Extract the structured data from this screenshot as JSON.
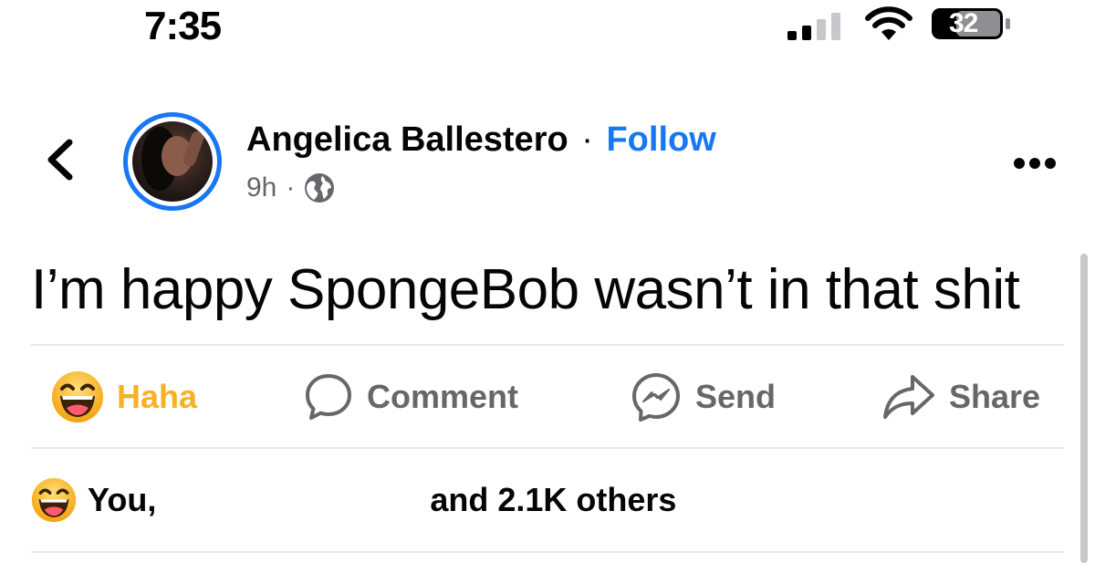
{
  "status_bar": {
    "time": "7:35",
    "battery": "32",
    "icons": [
      "cellular-signal-icon",
      "wifi-icon",
      "battery-icon"
    ]
  },
  "post": {
    "author": "Angelica Ballestero",
    "separator": "·",
    "follow_label": "Follow",
    "time_ago": "9h",
    "meta_separator": "·",
    "privacy_icon": "globe-icon",
    "text": "I’m happy SpongeBob wasn’t in that shit"
  },
  "actions": {
    "haha_label": "Haha",
    "comment_label": "Comment",
    "send_label": "Send",
    "share_label": "Share"
  },
  "reactions": {
    "summary": "You,                              and 2.1K others"
  },
  "colors": {
    "brand_blue": "#1877f2",
    "haha_yellow": "#f7b125",
    "secondary_text": "#65676b",
    "divider": "#e4e6eb"
  }
}
